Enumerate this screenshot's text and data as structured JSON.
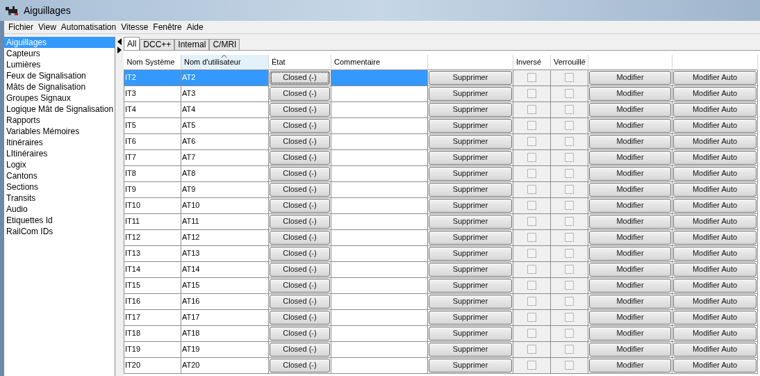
{
  "window": {
    "title": "Aiguillages"
  },
  "menu": [
    "Fichier",
    "View",
    "Automatisation",
    "Vitesse",
    "Fenêtre",
    "Aide"
  ],
  "sidebar": {
    "items": [
      {
        "label": "Aiguillages",
        "selected": true
      },
      {
        "label": "Capteurs",
        "selected": false
      },
      {
        "label": "Lumières",
        "selected": false
      },
      {
        "label": "Feux de Signalisation",
        "selected": false
      },
      {
        "label": "Mâts de Signalisation",
        "selected": false
      },
      {
        "label": "Groupes Signaux",
        "selected": false
      },
      {
        "label": "Logique Mât de Signalisation",
        "selected": false
      },
      {
        "label": "Rapports",
        "selected": false
      },
      {
        "label": "Variables Mémoires",
        "selected": false
      },
      {
        "label": "Itinéraires",
        "selected": false
      },
      {
        "label": "LItinéraires",
        "selected": false
      },
      {
        "label": "Logix",
        "selected": false
      },
      {
        "label": "Cantons",
        "selected": false
      },
      {
        "label": "Sections",
        "selected": false
      },
      {
        "label": "Transits",
        "selected": false
      },
      {
        "label": "Audio",
        "selected": false
      },
      {
        "label": "Etiquettes Id",
        "selected": false
      },
      {
        "label": "RailCom IDs",
        "selected": false
      }
    ]
  },
  "tabs": [
    {
      "label": "All",
      "selected": true
    },
    {
      "label": "DCC++",
      "selected": false
    },
    {
      "label": "Internal",
      "selected": false
    },
    {
      "label": "C/MRI",
      "selected": false
    }
  ],
  "table": {
    "columns": [
      {
        "label": "Nom Système",
        "sorted": false
      },
      {
        "label": "Nom d'utilisateur",
        "sorted": true
      },
      {
        "label": "État",
        "sorted": false
      },
      {
        "label": "Commentaire",
        "sorted": false
      },
      {
        "sorted": false
      },
      {
        "label": "Inversé",
        "sorted": false
      },
      {
        "label": "Verrouillé",
        "sorted": false
      },
      {
        "sorted": false
      },
      {
        "sorted": false
      }
    ],
    "rows": [
      {
        "system": "IT2",
        "user": "AT2",
        "state": "Closed (-)",
        "delete": "Supprimer",
        "inverted": false,
        "locked": false,
        "edit": "Modifier",
        "edit_auto": "Modifier Auto",
        "selected": true
      },
      {
        "system": "IT3",
        "user": "AT3",
        "state": "Closed (-)",
        "delete": "Supprimer",
        "inverted": false,
        "locked": false,
        "edit": "Modifier",
        "edit_auto": "Modifier Auto",
        "selected": false
      },
      {
        "system": "IT4",
        "user": "AT4",
        "state": "Closed (-)",
        "delete": "Supprimer",
        "inverted": false,
        "locked": false,
        "edit": "Modifier",
        "edit_auto": "Modifier Auto",
        "selected": false
      },
      {
        "system": "IT5",
        "user": "AT5",
        "state": "Closed (-)",
        "delete": "Supprimer",
        "inverted": false,
        "locked": false,
        "edit": "Modifier",
        "edit_auto": "Modifier Auto",
        "selected": false
      },
      {
        "system": "IT6",
        "user": "AT6",
        "state": "Closed (-)",
        "delete": "Supprimer",
        "inverted": false,
        "locked": false,
        "edit": "Modifier",
        "edit_auto": "Modifier Auto",
        "selected": false
      },
      {
        "system": "IT7",
        "user": "AT7",
        "state": "Closed (-)",
        "delete": "Supprimer",
        "inverted": false,
        "locked": false,
        "edit": "Modifier",
        "edit_auto": "Modifier Auto",
        "selected": false
      },
      {
        "system": "IT8",
        "user": "AT8",
        "state": "Closed (-)",
        "delete": "Supprimer",
        "inverted": false,
        "locked": false,
        "edit": "Modifier",
        "edit_auto": "Modifier Auto",
        "selected": false
      },
      {
        "system": "IT9",
        "user": "AT9",
        "state": "Closed (-)",
        "delete": "Supprimer",
        "inverted": false,
        "locked": false,
        "edit": "Modifier",
        "edit_auto": "Modifier Auto",
        "selected": false
      },
      {
        "system": "IT10",
        "user": "AT10",
        "state": "Closed (-)",
        "delete": "Supprimer",
        "inverted": false,
        "locked": false,
        "edit": "Modifier",
        "edit_auto": "Modifier Auto",
        "selected": false
      },
      {
        "system": "IT11",
        "user": "AT11",
        "state": "Closed (-)",
        "delete": "Supprimer",
        "inverted": false,
        "locked": false,
        "edit": "Modifier",
        "edit_auto": "Modifier Auto",
        "selected": false
      },
      {
        "system": "IT12",
        "user": "AT12",
        "state": "Closed (-)",
        "delete": "Supprimer",
        "inverted": false,
        "locked": false,
        "edit": "Modifier",
        "edit_auto": "Modifier Auto",
        "selected": false
      },
      {
        "system": "IT13",
        "user": "AT13",
        "state": "Closed (-)",
        "delete": "Supprimer",
        "inverted": false,
        "locked": false,
        "edit": "Modifier",
        "edit_auto": "Modifier Auto",
        "selected": false
      },
      {
        "system": "IT14",
        "user": "AT14",
        "state": "Closed (-)",
        "delete": "Supprimer",
        "inverted": false,
        "locked": false,
        "edit": "Modifier",
        "edit_auto": "Modifier Auto",
        "selected": false
      },
      {
        "system": "IT15",
        "user": "AT15",
        "state": "Closed (-)",
        "delete": "Supprimer",
        "inverted": false,
        "locked": false,
        "edit": "Modifier",
        "edit_auto": "Modifier Auto",
        "selected": false
      },
      {
        "system": "IT16",
        "user": "AT16",
        "state": "Closed (-)",
        "delete": "Supprimer",
        "inverted": false,
        "locked": false,
        "edit": "Modifier",
        "edit_auto": "Modifier Auto",
        "selected": false
      },
      {
        "system": "IT17",
        "user": "AT17",
        "state": "Closed (-)",
        "delete": "Supprimer",
        "inverted": false,
        "locked": false,
        "edit": "Modifier",
        "edit_auto": "Modifier Auto",
        "selected": false
      },
      {
        "system": "IT18",
        "user": "AT18",
        "state": "Closed (-)",
        "delete": "Supprimer",
        "inverted": false,
        "locked": false,
        "edit": "Modifier",
        "edit_auto": "Modifier Auto",
        "selected": false
      },
      {
        "system": "IT19",
        "user": "AT19",
        "state": "Closed (-)",
        "delete": "Supprimer",
        "inverted": false,
        "locked": false,
        "edit": "Modifier",
        "edit_auto": "Modifier Auto",
        "selected": false
      },
      {
        "system": "IT20",
        "user": "AT20",
        "state": "Closed (-)",
        "delete": "Supprimer",
        "inverted": false,
        "locked": false,
        "edit": "Modifier",
        "edit_auto": "Modifier Auto",
        "selected": false
      }
    ]
  }
}
